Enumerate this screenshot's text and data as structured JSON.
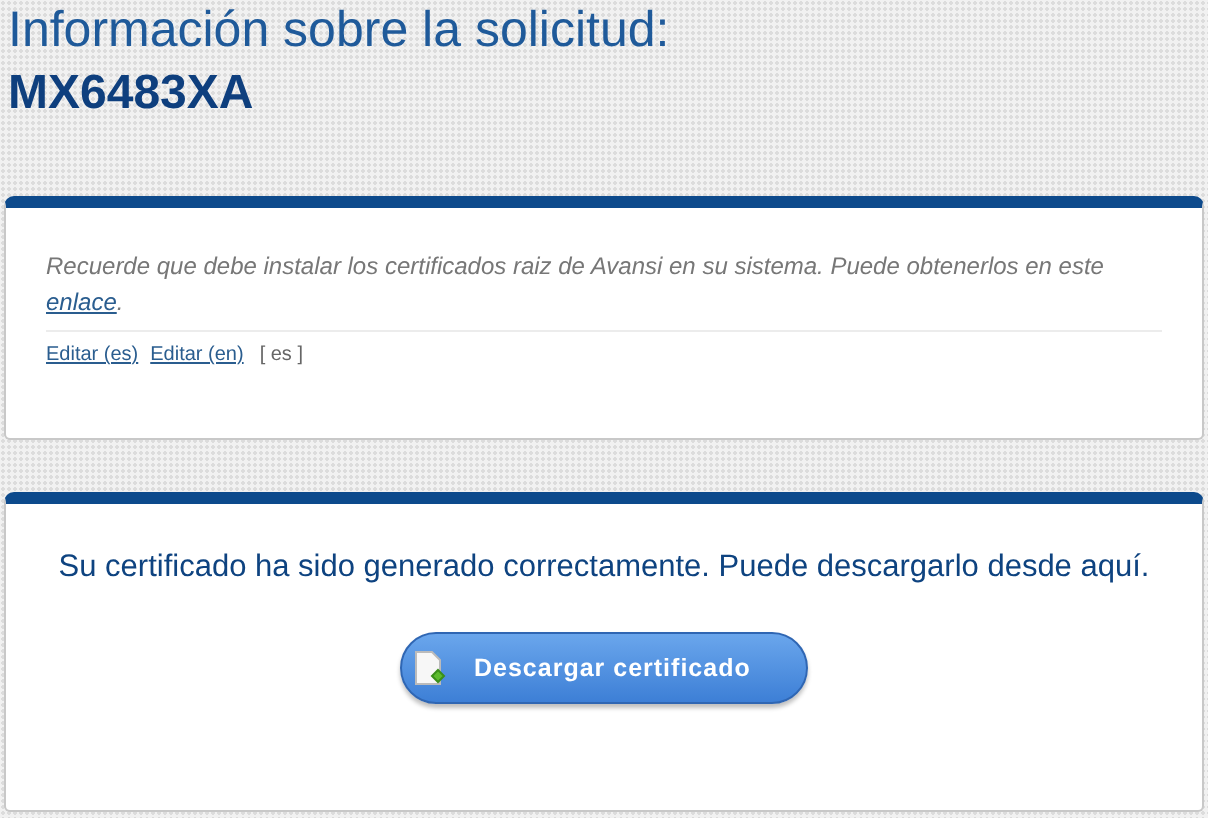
{
  "page_title": "Información sobre la solicitud:",
  "request_id": "MX6483XA",
  "notice_panel": {
    "text_before": "Recuerde que debe instalar los certificados raiz de Avansi en su sistema. Puede obtenerlos en este ",
    "link": "enlace",
    "text_after": ".",
    "edit_links": [
      "Editar (es)",
      "Editar (en)"
    ],
    "language": "[ es ]"
  },
  "result_panel": {
    "message": "Su certificado ha sido generado correctamente. Puede descargarlo desde aquí.",
    "button": "Descargar certificado"
  }
}
